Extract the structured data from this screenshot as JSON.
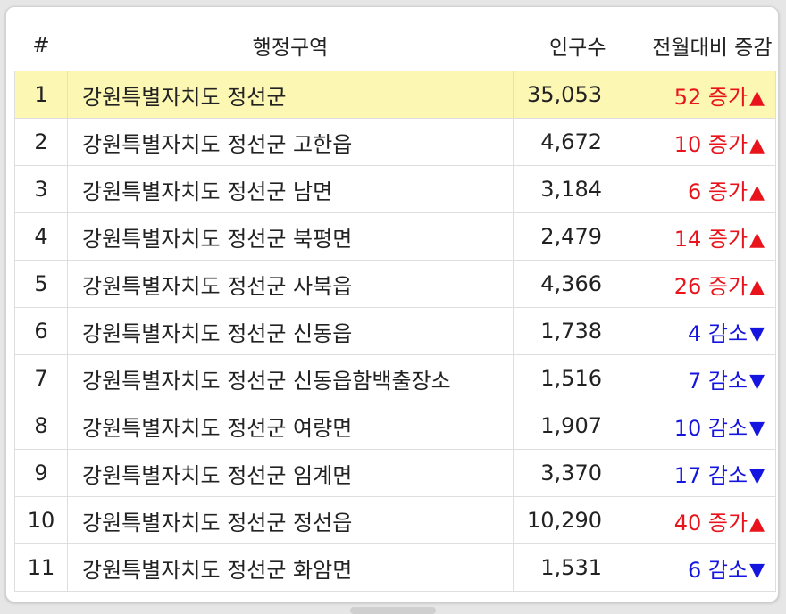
{
  "headers": {
    "num": "#",
    "name": "행정구역",
    "population": "인구수",
    "change": "전월대비 증감"
  },
  "colors": {
    "increase": "#e8131b",
    "decrease": "#1515e0",
    "highlight_row": "#fdf7b4"
  },
  "rows": [
    {
      "num": "1",
      "name": "강원특별자치도 정선군",
      "population": "35,053",
      "change_value": "52",
      "change_word": "증가",
      "direction": "up",
      "highlight": true
    },
    {
      "num": "2",
      "name": "강원특별자치도 정선군 고한읍",
      "population": "4,672",
      "change_value": "10",
      "change_word": "증가",
      "direction": "up"
    },
    {
      "num": "3",
      "name": "강원특별자치도 정선군 남면",
      "population": "3,184",
      "change_value": "6",
      "change_word": "증가",
      "direction": "up"
    },
    {
      "num": "4",
      "name": "강원특별자치도 정선군 북평면",
      "population": "2,479",
      "change_value": "14",
      "change_word": "증가",
      "direction": "up"
    },
    {
      "num": "5",
      "name": "강원특별자치도 정선군 사북읍",
      "population": "4,366",
      "change_value": "26",
      "change_word": "증가",
      "direction": "up"
    },
    {
      "num": "6",
      "name": "강원특별자치도 정선군 신동읍",
      "population": "1,738",
      "change_value": "4",
      "change_word": "감소",
      "direction": "down"
    },
    {
      "num": "7",
      "name": "강원특별자치도 정선군 신동읍함백출장소",
      "population": "1,516",
      "change_value": "7",
      "change_word": "감소",
      "direction": "down"
    },
    {
      "num": "8",
      "name": "강원특별자치도 정선군 여량면",
      "population": "1,907",
      "change_value": "10",
      "change_word": "감소",
      "direction": "down"
    },
    {
      "num": "9",
      "name": "강원특별자치도 정선군 임계면",
      "population": "3,370",
      "change_value": "17",
      "change_word": "감소",
      "direction": "down"
    },
    {
      "num": "10",
      "name": "강원특별자치도 정선군 정선읍",
      "population": "10,290",
      "change_value": "40",
      "change_word": "증가",
      "direction": "up"
    },
    {
      "num": "11",
      "name": "강원특별자치도 정선군 화암면",
      "population": "1,531",
      "change_value": "6",
      "change_word": "감소",
      "direction": "down"
    }
  ]
}
